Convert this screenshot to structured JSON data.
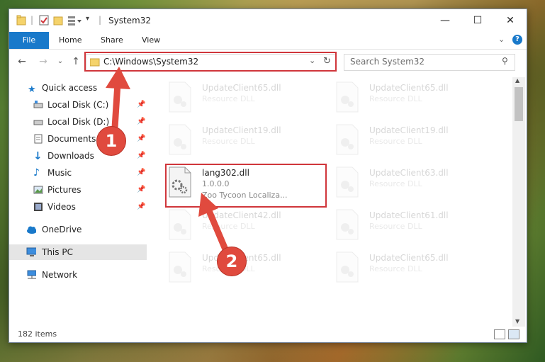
{
  "window": {
    "title": "System32",
    "controls": {
      "minimize": "—",
      "maximize": "☐",
      "close": "✕"
    }
  },
  "ribbon": {
    "tabs": [
      "File",
      "Home",
      "Share",
      "View"
    ],
    "help_icon": "?"
  },
  "address": {
    "path": "C:\\Windows\\System32",
    "search_placeholder": "Search System32"
  },
  "sidebar": {
    "items": [
      {
        "label": "Quick access",
        "icon": "star-icon",
        "pinned": false
      },
      {
        "label": "Local Disk (C:)",
        "icon": "drive-icon",
        "pinned": true
      },
      {
        "label": "Local Disk (D:)",
        "icon": "drive-icon",
        "pinned": true
      },
      {
        "label": "Documents",
        "icon": "documents-icon",
        "pinned": true
      },
      {
        "label": "Downloads",
        "icon": "download-icon",
        "pinned": true
      },
      {
        "label": "Music",
        "icon": "music-icon",
        "pinned": true
      },
      {
        "label": "Pictures",
        "icon": "pictures-icon",
        "pinned": true
      },
      {
        "label": "Videos",
        "icon": "videos-icon",
        "pinned": true
      },
      {
        "label": "OneDrive",
        "icon": "cloud-icon",
        "pinned": false
      },
      {
        "label": "This PC",
        "icon": "computer-icon",
        "pinned": false
      },
      {
        "label": "Network",
        "icon": "network-icon",
        "pinned": false
      }
    ]
  },
  "files": [
    {
      "name": "UpdateClient65.dll",
      "type": "Resource DLL",
      "faded": true
    },
    {
      "name": "UpdateClient65.dll",
      "type": "Resource DLL",
      "faded": true
    },
    {
      "name": "UpdateClient19.dll",
      "type": "Resource DLL",
      "faded": true
    },
    {
      "name": "UpdateClient19.dll",
      "type": "Resource DLL",
      "faded": true
    },
    {
      "name": "lang302.dll",
      "version": "1.0.0.0",
      "description": "Zoo Tycoon Localiza...",
      "faded": false
    },
    {
      "name": "UpdateClient63.dll",
      "type": "Resource DLL",
      "faded": true
    },
    {
      "name": "UpdateClient42.dll",
      "type": "Resource DLL",
      "faded": true
    },
    {
      "name": "UpdateClient61.dll",
      "type": "Resource DLL",
      "faded": true
    },
    {
      "name": "UpdateClient65.dll",
      "type": "Resource DLL",
      "faded": true
    },
    {
      "name": "UpdateClient65.dll",
      "type": "Resource DLL",
      "faded": true
    }
  ],
  "status": {
    "item_count": "182 items"
  },
  "annotations": {
    "callout_1": "1",
    "callout_2": "2"
  },
  "colors": {
    "accent": "#1979ca",
    "highlight_red": "#d0363b",
    "callout": "#e04a3e"
  }
}
